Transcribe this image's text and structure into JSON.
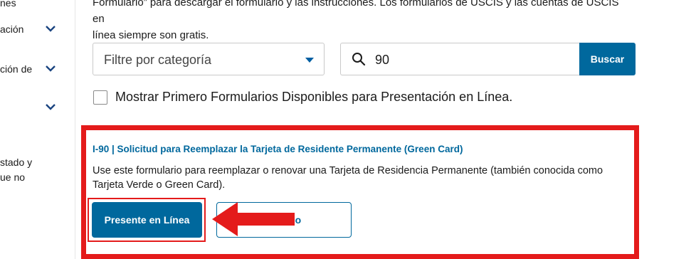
{
  "sidebar": {
    "items": [
      {
        "label": "nes"
      },
      {
        "label": "ación"
      },
      {
        "label": "ción de"
      },
      {
        "label": ""
      },
      {
        "label": "stado y"
      },
      {
        "label": "ue no"
      }
    ]
  },
  "intro": {
    "line1": "Formulario” para descargar el formulario y las instrucciones. Los formularios de USCIS y las cuentas de USCIS en",
    "line2": "línea siempre son gratis."
  },
  "filter": {
    "placeholder": "Filtre por categoría"
  },
  "search": {
    "value": "90",
    "button_label": "Buscar"
  },
  "checkbox": {
    "label": "Mostrar Primero Formularios Disponibles para Presentación en Línea."
  },
  "form": {
    "title": "I-90 | Solicitud para Reemplazar la Tarjeta de Residente Permanente (Green Card)",
    "description_line1": "Use este formulario para reemplazar o renovar una Tarjeta de Residencia Permanente (también conocida como",
    "description_line2": "Tarjeta Verde o Green Card).",
    "primary_button": "Presente en Línea",
    "secondary_button": "Formulario"
  },
  "colors": {
    "accent": "#00689d",
    "highlight": "#e41b1b"
  },
  "icons": {
    "search": "search-icon",
    "chevron": "chevron-down-icon",
    "arrow": "arrow-left-icon"
  }
}
